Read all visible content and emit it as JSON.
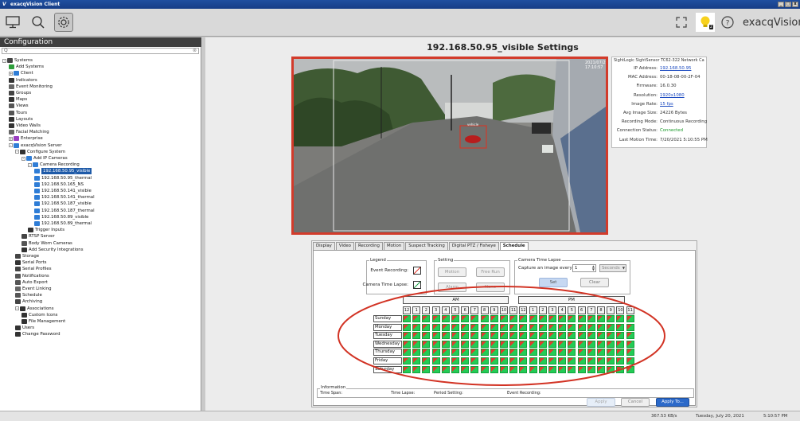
{
  "window": {
    "title": "exacqVision Client"
  },
  "toolbar": {
    "logo": "exacqVision",
    "notification_count": "2"
  },
  "sidebar": {
    "header": "Configuration",
    "search_placeholder": "Q",
    "items": [
      {
        "label": "Systems",
        "indent": 0,
        "icon": "#444",
        "toggle": "-"
      },
      {
        "label": "Add Systems",
        "indent": 1,
        "icon": "#2e9e3b"
      },
      {
        "label": "Client",
        "indent": 1,
        "icon": "#2f7dd6",
        "toggle": "+"
      },
      {
        "label": "Indicators",
        "indent": 1,
        "icon": "#333"
      },
      {
        "label": "Event Monitoring",
        "indent": 1,
        "icon": "#666"
      },
      {
        "label": "Groups",
        "indent": 1,
        "icon": "#444"
      },
      {
        "label": "Maps",
        "indent": 1,
        "icon": "#333"
      },
      {
        "label": "Views",
        "indent": 1,
        "icon": "#555"
      },
      {
        "label": "Tours",
        "indent": 1,
        "icon": "#555"
      },
      {
        "label": "Layouts",
        "indent": 1,
        "icon": "#333"
      },
      {
        "label": "Video Walls",
        "indent": 1,
        "icon": "#333"
      },
      {
        "label": "Facial Matching",
        "indent": 1,
        "icon": "#666"
      },
      {
        "label": "Enterprise",
        "indent": 1,
        "icon": "#9b3fc2",
        "toggle": "+"
      },
      {
        "label": "exacqVision Server",
        "indent": 1,
        "icon": "#2f7dd6",
        "toggle": "-"
      },
      {
        "label": "Configure System",
        "indent": 2,
        "icon": "#333",
        "toggle": "-"
      },
      {
        "label": "Add IP Cameras",
        "indent": 3,
        "icon": "#2f7dd6",
        "toggle": "-"
      },
      {
        "label": "Camera Recording",
        "indent": 4,
        "icon": "#2f7dd6",
        "toggle": "-"
      },
      {
        "label": "192.168.50.95_visible",
        "indent": 5,
        "icon": "#2f7dd6",
        "selected": true
      },
      {
        "label": "192.168.50.95_thermal",
        "indent": 5,
        "icon": "#2f7dd6"
      },
      {
        "label": "192.168.50.165_NS",
        "indent": 5,
        "icon": "#2f7dd6"
      },
      {
        "label": "192.168.50.141_visible",
        "indent": 5,
        "icon": "#2f7dd6"
      },
      {
        "label": "192.168.50.141_thermal",
        "indent": 5,
        "icon": "#2f7dd6"
      },
      {
        "label": "192.168.50.187_visible",
        "indent": 5,
        "icon": "#2f7dd6"
      },
      {
        "label": "192.168.50.187_thermal",
        "indent": 5,
        "icon": "#2f7dd6"
      },
      {
        "label": "192.168.50.89_visible",
        "indent": 5,
        "icon": "#2f7dd6"
      },
      {
        "label": "192.168.50.89_thermal",
        "indent": 5,
        "icon": "#2f7dd6"
      },
      {
        "label": "Trigger Inputs",
        "indent": 4,
        "icon": "#333"
      },
      {
        "label": "RTSP Server",
        "indent": 3,
        "icon": "#444"
      },
      {
        "label": "Body Worn Cameras",
        "indent": 3,
        "icon": "#555"
      },
      {
        "label": "Add Security Integrations",
        "indent": 3,
        "icon": "#333"
      },
      {
        "label": "Storage",
        "indent": 2,
        "icon": "#444"
      },
      {
        "label": "Serial Ports",
        "indent": 2,
        "icon": "#333"
      },
      {
        "label": "Serial Profiles",
        "indent": 2,
        "icon": "#444"
      },
      {
        "label": "Notifications",
        "indent": 2,
        "icon": "#555"
      },
      {
        "label": "Auto Export",
        "indent": 2,
        "icon": "#555"
      },
      {
        "label": "Event Linking",
        "indent": 2,
        "icon": "#666"
      },
      {
        "label": "Schedule",
        "indent": 2,
        "icon": "#555"
      },
      {
        "label": "Archiving",
        "indent": 2,
        "icon": "#444"
      },
      {
        "label": "Associations",
        "indent": 2,
        "icon": "#333",
        "toggle": "-"
      },
      {
        "label": "Custom Icons",
        "indent": 3,
        "icon": "#333"
      },
      {
        "label": "File Management",
        "indent": 3,
        "icon": "#333"
      },
      {
        "label": "Users",
        "indent": 2,
        "icon": "#333"
      },
      {
        "label": "Change Password",
        "indent": 2,
        "icon": "#333"
      }
    ]
  },
  "main": {
    "title": "192.168.50.95_visible Settings"
  },
  "camera": {
    "overlay_text": "2021/07/20 17:10:57",
    "detect_label": "vehicle"
  },
  "info": {
    "title": "SightLogic SightSensor TC62-322 Network Ca",
    "rows": [
      {
        "k": "IP Address:",
        "v": "192.168.50.95",
        "kind": "link"
      },
      {
        "k": "MAC Address:",
        "v": "00-18-08-00-2F-04"
      },
      {
        "k": "Firmware:",
        "v": "16.0.30"
      },
      {
        "k": "Resolution:",
        "v": "1920x1080",
        "kind": "link"
      },
      {
        "k": "Image Rate:",
        "v": "15 fps",
        "kind": "link"
      },
      {
        "k": "Avg Image Size:",
        "v": "24226 Bytes"
      },
      {
        "k": "Recording Mode:",
        "v": "Continuous Recording"
      },
      {
        "k": "Connection Status:",
        "v": "Connected",
        "kind": "ok"
      },
      {
        "k": "Last Motion Time:",
        "v": "7/20/2021 5:10:55 PM"
      }
    ]
  },
  "tabs": [
    "Display",
    "Video",
    "Recording",
    "Motion",
    "Suspect Tracking",
    "Digital PTZ / Fisheye",
    "Schedule"
  ],
  "active_tab": "Schedule",
  "legend": {
    "title": "Legend",
    "event_recording": "Event Recording:",
    "camera_time_lapse": "Camera Time Lapse:"
  },
  "setting": {
    "title": "Setting",
    "motion": "Motion",
    "free_run": "Free Run",
    "alarm": "Alarm",
    "none": "None"
  },
  "time_lapse": {
    "title": "Camera Time Lapse",
    "capture_label": "Capture an image every",
    "interval_value": "1",
    "unit": "Seconds",
    "set": "Set",
    "clear": "Clear"
  },
  "schedule": {
    "am": "AM",
    "pm": "PM",
    "hours": [
      "12",
      "1",
      "2",
      "3",
      "4",
      "5",
      "6",
      "7",
      "8",
      "9",
      "10",
      "11",
      "12",
      "1",
      "2",
      "3",
      "4",
      "5",
      "6",
      "7",
      "8",
      "9",
      "10",
      "11"
    ],
    "days": [
      "Sunday",
      "Monday",
      "Tuesday",
      "Wednesday",
      "Thursday",
      "Friday",
      "Saturday"
    ]
  },
  "information": {
    "title": "Information",
    "time_span": "Time Span:",
    "time_lapse": "Time Lapse:",
    "period_setting": "Period Setting:",
    "event_recording": "Event Recording:"
  },
  "buttons": {
    "apply": "Apply",
    "cancel": "Cancel",
    "apply_to": "Apply To..."
  },
  "status": {
    "rate": "367.53 KB/s",
    "date": "Tuesday, July 20, 2021",
    "time": "5:10:57 PM"
  }
}
